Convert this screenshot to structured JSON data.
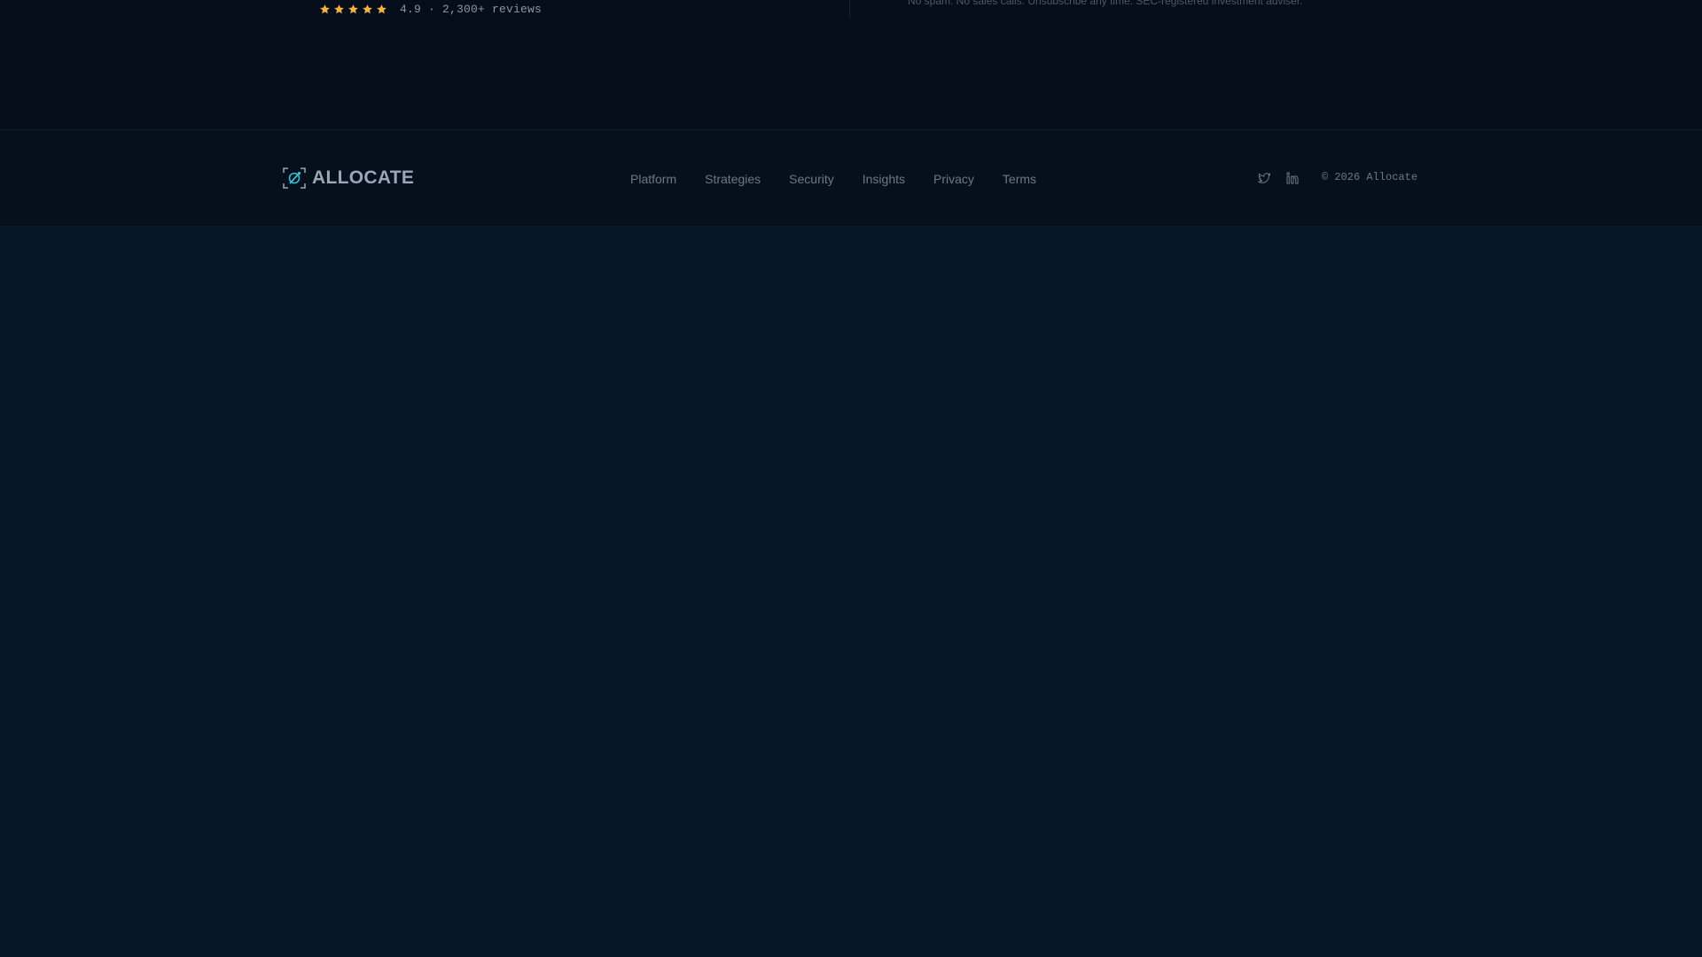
{
  "hero": {
    "rating": {
      "stars": 5,
      "star_color": "#f6b23c",
      "text": "4.9 · 2,300+ reviews"
    },
    "disclaimer": "No spam. No sales calls. Unsubscribe any time. SEC-registered investment adviser."
  },
  "footer": {
    "brand": {
      "icon": "compass-logo-icon",
      "name": "ALLOCATE",
      "accent": "#2ec4d6"
    },
    "nav": [
      {
        "label": "Platform"
      },
      {
        "label": "Strategies"
      },
      {
        "label": "Security"
      },
      {
        "label": "Insights"
      },
      {
        "label": "Privacy"
      },
      {
        "label": "Terms"
      }
    ],
    "social": [
      {
        "icon": "twitter-icon"
      },
      {
        "icon": "linkedin-icon"
      }
    ],
    "copyright": "© 2026 Allocate"
  }
}
